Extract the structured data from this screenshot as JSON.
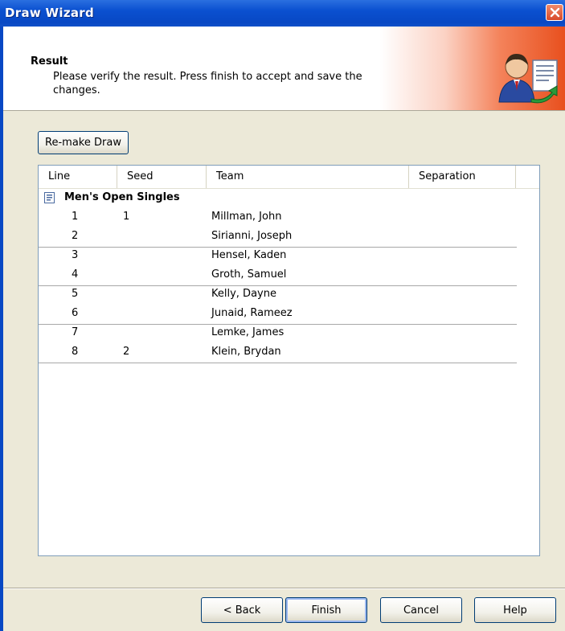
{
  "window": {
    "title": "Draw Wizard"
  },
  "header": {
    "title": "Result",
    "description": "Please verify the result. Press finish to accept and save the changes."
  },
  "remake_button": "Re-make Draw",
  "list": {
    "columns": [
      "Line",
      "Seed",
      "Team",
      "Separation"
    ],
    "group": "Men's Open Singles",
    "rows": [
      {
        "line": "1",
        "seed": "1",
        "team": "Millman, John"
      },
      {
        "line": "2",
        "seed": "",
        "team": "Sirianni, Joseph"
      },
      {
        "line": "3",
        "seed": "",
        "team": "Hensel, Kaden"
      },
      {
        "line": "4",
        "seed": "",
        "team": "Groth, Samuel"
      },
      {
        "line": "5",
        "seed": "",
        "team": "Kelly, Dayne"
      },
      {
        "line": "6",
        "seed": "",
        "team": "Junaid, Rameez"
      },
      {
        "line": "7",
        "seed": "",
        "team": "Lemke, James"
      },
      {
        "line": "8",
        "seed": "2",
        "team": "Klein, Brydan"
      }
    ]
  },
  "buttons": {
    "back": "< Back",
    "finish": "Finish",
    "cancel": "Cancel",
    "help": "Help"
  },
  "icons": {
    "close": "close-icon",
    "wizard": "user-document-icon",
    "group": "document-icon"
  },
  "colors": {
    "titlebar": "#0848c4",
    "close": "#d84a2a",
    "header_accent": "#e8501e"
  }
}
